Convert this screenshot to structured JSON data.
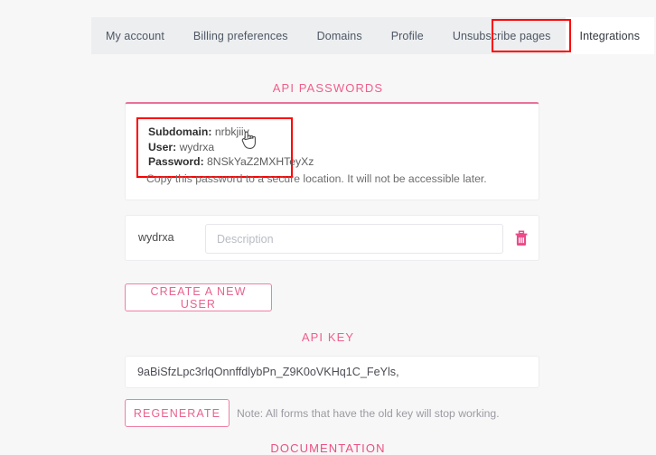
{
  "tabs": [
    {
      "label": "My account",
      "active": false
    },
    {
      "label": "Billing preferences",
      "active": false
    },
    {
      "label": "Domains",
      "active": false
    },
    {
      "label": "Profile",
      "active": false
    },
    {
      "label": "Unsubscribe pages",
      "active": false
    },
    {
      "label": "Integrations",
      "active": true
    }
  ],
  "sections": {
    "api_passwords_title": "API PASSWORDS",
    "api_key_title": "API KEY",
    "documentation_title": "DOCUMENTATION"
  },
  "credentials": {
    "subdomain_label": "Subdomain:",
    "subdomain_value": "nrbkjiiy",
    "user_label": "User:",
    "user_value": "wydrxa",
    "password_label": "Password:",
    "password_value": "8NSkYaZ2MXHTeyXz",
    "note": "Copy this password to a secure location. It will not be accessible later."
  },
  "user_row": {
    "username": "wydrxa",
    "description_value": "",
    "description_placeholder": "Description",
    "delete_icon": "trash-icon"
  },
  "buttons": {
    "create_user": "CREATE A NEW USER",
    "regenerate": "REGENERATE"
  },
  "api_key": {
    "value": "9aBiSfzLpc3rlqOnnffdlybPn_Z9K0oVKHq1C_FeYls,",
    "note": "Note: All forms that have the old key will stop working."
  },
  "colors": {
    "accent_pink": "#e8628d",
    "title_pink": "#ef5f8a",
    "annotation_red": "#ff0000",
    "page_bg": "#f7f7f8",
    "tabbar_bg": "#eceef0"
  },
  "annotations": [
    {
      "name": "integrations-tab-highlight",
      "color": "#ff0000"
    },
    {
      "name": "credentials-highlight",
      "color": "#ff0000"
    }
  ]
}
